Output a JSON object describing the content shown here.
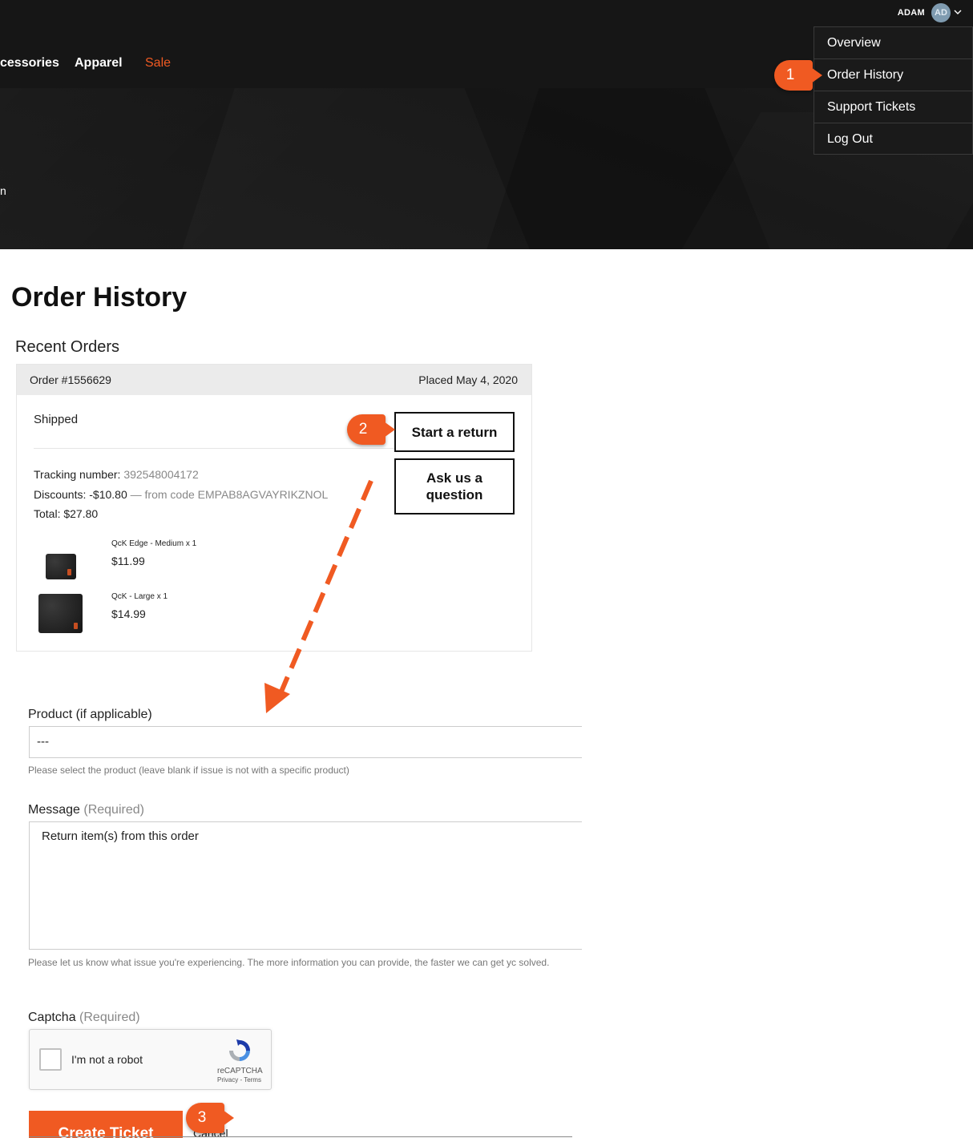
{
  "header": {
    "nav": {
      "accessories": "cessories",
      "apparel": "Apparel",
      "sale": "Sale"
    },
    "hero_stub": "n",
    "account": {
      "name": "ADAM",
      "initials": "AD",
      "chevron": "⌄"
    },
    "dropdown": [
      "Overview",
      "Order History",
      "Support Tickets",
      "Log Out"
    ]
  },
  "callouts": {
    "step1": "1",
    "step2": "2",
    "step3": "3"
  },
  "page": {
    "title": "Order History",
    "recent_title": "Recent Orders"
  },
  "order": {
    "number": "Order #1556629",
    "placed": "Placed May 4, 2020",
    "status": "Shipped",
    "tracking_label": "Tracking number:",
    "tracking_value": "392548004172",
    "discounts_label": "Discounts:",
    "discounts_value": "-$10.80",
    "discounts_code": "— from code EMPAB8AGVAYRIKZNOL",
    "total": "Total: $27.80",
    "start_return": "Start a return",
    "ask_question": "Ask us a question",
    "items": [
      {
        "name": "QcK Edge - Medium x 1",
        "price": "$11.99"
      },
      {
        "name": "QcK - Large x 1",
        "price": "$14.99"
      }
    ]
  },
  "form": {
    "product_label": "Product (if applicable)",
    "product_value": "---",
    "product_help": "Please select the product (leave blank if issue is not with a specific product)",
    "message_label": "Message",
    "message_required": "(Required)",
    "message_value": "Return item(s) from this order",
    "message_help": "Please let us know what issue you're experiencing. The more information you can provide, the faster we can get yc solved.",
    "captcha_label": "Captcha",
    "captcha_required": "(Required)",
    "captcha_text": "I'm not a robot",
    "captcha_brand": "reCAPTCHA",
    "captcha_links": "Privacy - Terms",
    "submit": "Create Ticket",
    "cancel": "Cancel"
  },
  "colors": {
    "accent": "#f05a22",
    "dark": "#161616"
  }
}
